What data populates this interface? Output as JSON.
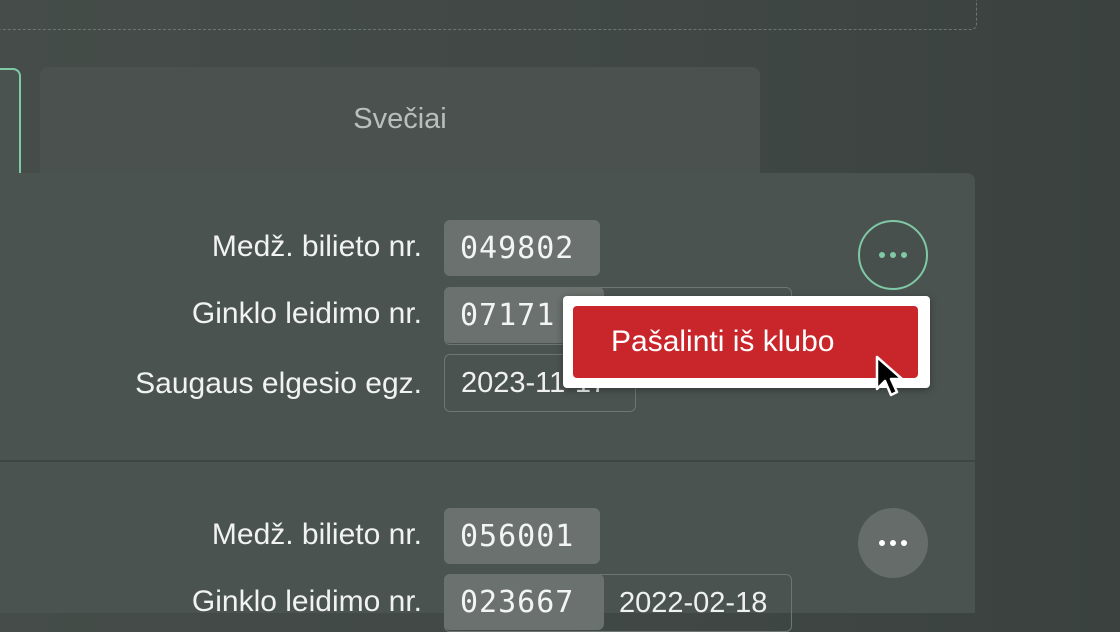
{
  "tabs": {
    "guests_label": "Svečiai"
  },
  "members": [
    {
      "membership_label": "Medž. bilieto nr.",
      "membership_number": "049802",
      "weapon_label": "Ginklo leidimo nr.",
      "weapon_number": "07171",
      "safety_label": "Saugaus elgesio egz.",
      "safety_date": "2023-11-17"
    },
    {
      "membership_label": "Medž. bilieto nr.",
      "membership_number": "056001",
      "weapon_label": "Ginklo leidimo nr.",
      "weapon_number": "023667",
      "weapon_date": "2022-02-18"
    }
  ],
  "context_menu": {
    "remove_label": "Pašalinti iš klubo"
  },
  "colors": {
    "accent": "#7fc9a6",
    "danger": "#c8262b",
    "background": "#434a47"
  },
  "icons": {
    "more": "more-horizontal-icon",
    "cursor": "mouse-pointer-icon"
  }
}
